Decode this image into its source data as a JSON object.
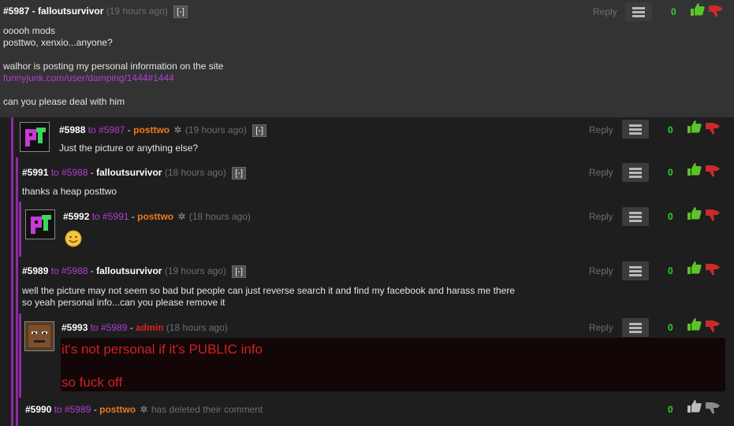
{
  "colors": {
    "page_bg": "#1e1e1e",
    "top_comment_bg": "#333333",
    "link_purple": "#b43ed2",
    "username_orange": "#f0781e",
    "username_red": "#e01e1e",
    "score_green": "#29d829",
    "thumb_up_green": "#5ac42a",
    "thumb_down_red": "#cc2a2a"
  },
  "comments": [
    {
      "id": "#5987",
      "to": "",
      "user": "falloutsurvivor",
      "time": "(19 hours ago)",
      "collapse": "[-]",
      "lines": [
        "ooooh mods",
        "posttwo, xenxio...anyone?",
        "",
        "walhor is posting my personal information on the site"
      ],
      "link": "funnyjunk.com/user/damping/1444#1444",
      "closing": "can you please deal with him",
      "reply": "Reply",
      "score": "0"
    },
    {
      "id": "#5988",
      "to": "to #5987",
      "user": "posttwo",
      "time": "(19 hours ago)",
      "collapse": "[-]",
      "text": "Just the picture or anything else?",
      "reply": "Reply",
      "score": "0",
      "avatar": "posttwo-logo"
    },
    {
      "id": "#5991",
      "to": "to #5988",
      "user": "falloutsurvivor",
      "time": "(18 hours ago)",
      "collapse": "[-]",
      "text": "thanks a heap posttwo",
      "reply": "Reply",
      "score": "0"
    },
    {
      "id": "#5992",
      "to": "to #5991",
      "user": "posttwo",
      "time": "(18 hours ago)",
      "text": "",
      "emoji": "smiley-face-icon",
      "reply": "Reply",
      "score": "0",
      "avatar": "posttwo-logo"
    },
    {
      "id": "#5989",
      "to": "to #5988",
      "user": "falloutsurvivor",
      "time": "(19 hours ago)",
      "collapse": "[-]",
      "line1": "well the picture may not seem so bad but people can just reverse search it and find my facebook and harass me there",
      "line2": "so yeah personal info...can you please remove it",
      "reply": "Reply",
      "score": "0"
    },
    {
      "id": "#5993",
      "to": "to #5989",
      "user": "admin",
      "time": "(18 hours ago)",
      "line1": "it's not personal if it's PUBLIC info",
      "line2": "so fuck off",
      "reply": "Reply",
      "score": "0",
      "avatar": "admin-face"
    },
    {
      "id": "#5990",
      "to": "to #5989",
      "user": "posttwo",
      "deleted_text": "has deleted their comment",
      "score": "0"
    }
  ]
}
